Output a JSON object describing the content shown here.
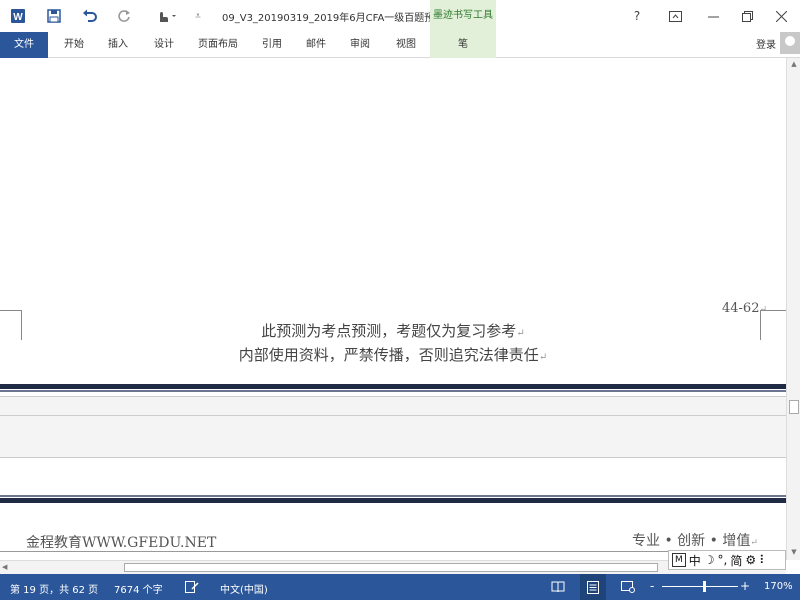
{
  "window": {
    "title": "09_V3_20190319_2019年6月CFA一级百题预...",
    "contextual_tab_group": "墨迹书写工具",
    "help_label": "?",
    "sign_in": "登录"
  },
  "quick_access": [
    "word-logo-icon",
    "save-icon",
    "undo-icon",
    "redo-icon",
    "touch-mode-icon",
    "customize-qat-icon"
  ],
  "ribbon": {
    "tabs": [
      "文件",
      "开始",
      "插入",
      "设计",
      "页面布局",
      "引用",
      "邮件",
      "审阅",
      "视图",
      "笔"
    ],
    "active_tab": "文件",
    "contextual_tab": "笔"
  },
  "document": {
    "footer_line1": "此预测为考点预测，考题仅为复习参考",
    "footer_line2": "内部使用资料，严禁传播，否则追究法律责任",
    "page_number": "44-62",
    "next_header_left": "金程教育WWW.GFEDU.NET",
    "next_header_right": "专业 • 创新 • 增值",
    "paragraph_mark": "↵"
  },
  "ime": {
    "mode": "M",
    "lang": "中",
    "moon": "☽",
    "punct": "°,",
    "script": "简",
    "settings": "⚙",
    "more": "⠇"
  },
  "status_bar": {
    "page_info": "第 19 页，共 62 页",
    "word_count": "7674 个字",
    "language": "中文(中国)",
    "zoom_minus": "-",
    "zoom_plus": "+",
    "zoom_level": "170%",
    "zoom_fraction": 0.57
  },
  "colors": {
    "accent": "#2b579a",
    "contextual_green": "#e2f0d9",
    "separator_navy": "#1f2a44"
  }
}
